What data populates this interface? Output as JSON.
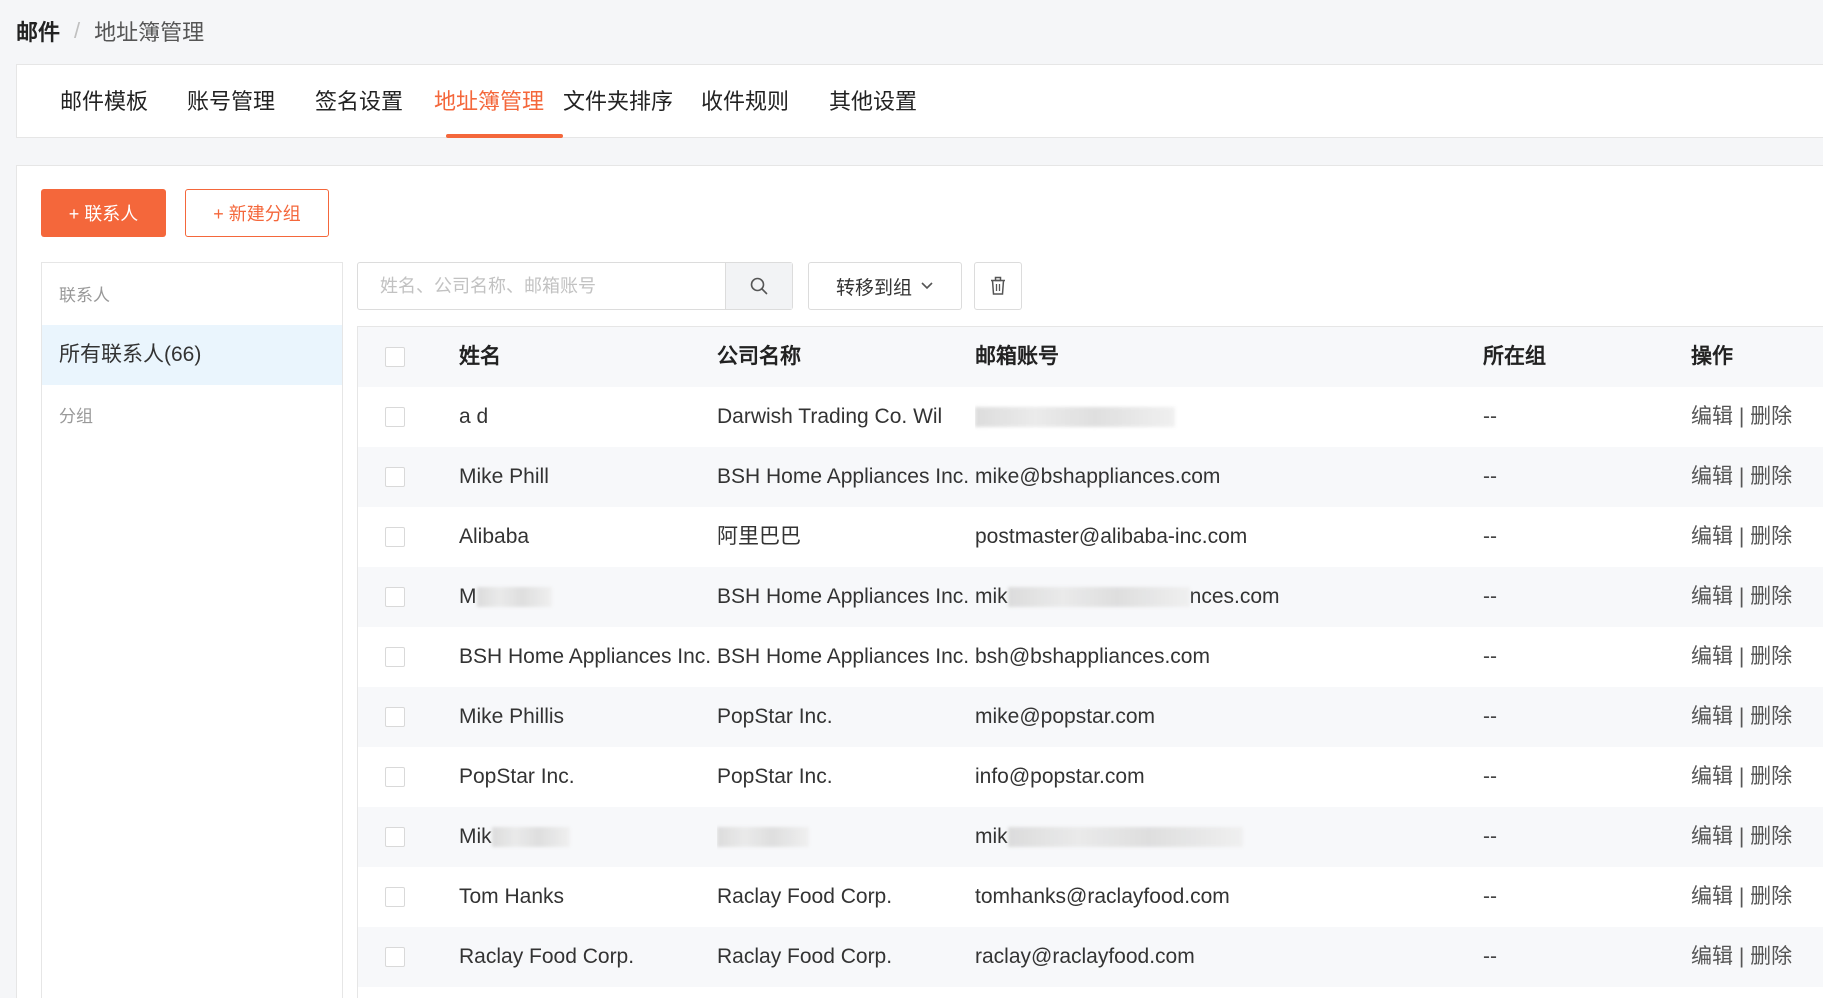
{
  "breadcrumb": {
    "root": "邮件",
    "separator": "/",
    "current": "地址簿管理"
  },
  "tabs": [
    {
      "label": "邮件模板",
      "active": false
    },
    {
      "label": "账号管理",
      "active": false
    },
    {
      "label": "签名设置",
      "active": false
    },
    {
      "label": "地址簿管理",
      "active": true
    },
    {
      "label": "文件夹排序",
      "active": false
    },
    {
      "label": "收件规则",
      "active": false
    },
    {
      "label": "其他设置",
      "active": false
    }
  ],
  "toolbar": {
    "add_contact_label": "+ 联系人",
    "new_group_label": "+ 新建分组",
    "search_placeholder": "姓名、公司名称、邮箱账号",
    "move_to_group_label": "转移到组"
  },
  "sidebar": {
    "contacts_section": "联系人",
    "all_contacts_label": "所有联系人(66)",
    "groups_section": "分组"
  },
  "table": {
    "headers": {
      "name": "姓名",
      "company": "公司名称",
      "email": "邮箱账号",
      "group": "所在组",
      "action": "操作"
    },
    "action_edit": "编辑",
    "action_sep": "|",
    "action_delete": "删除",
    "rows": [
      {
        "name": "a d",
        "company": "Darwish Trading Co. Wil",
        "email": "",
        "group": "--"
      },
      {
        "name": "Mike Phill",
        "company": "BSH Home Appliances Inc.",
        "email": "mike@bshappliances.com",
        "group": "--"
      },
      {
        "name": "Alibaba",
        "company": "阿里巴巴",
        "email": "postmaster@alibaba-inc.com",
        "group": "--"
      },
      {
        "name": "M",
        "company": "BSH Home Appliances Inc.",
        "email": "mik",
        "email_tail": "nces.com",
        "group": "--"
      },
      {
        "name": "BSH Home Appliances Inc.",
        "company": "BSH Home Appliances Inc.",
        "email": "bsh@bshappliances.com",
        "group": "--"
      },
      {
        "name": "Mike Phillis",
        "company": "PopStar Inc.",
        "email": "mike@popstar.com",
        "group": "--"
      },
      {
        "name": "PopStar Inc.",
        "company": "PopStar Inc.",
        "email": "info@popstar.com",
        "group": "--"
      },
      {
        "name": "Mik",
        "company": "",
        "email": "mik",
        "group": "--"
      },
      {
        "name": "Tom Hanks",
        "company": "Raclay Food Corp.",
        "email": "tomhanks@raclayfood.com",
        "group": "--"
      },
      {
        "name": "Raclay Food Corp.",
        "company": "Raclay Food Corp.",
        "email": "raclay@raclayfood.com",
        "group": "--"
      }
    ]
  },
  "colors": {
    "accent": "#f4673b",
    "selected_bg": "#eaf5fd",
    "stripe_bg": "#f7f8fa"
  }
}
